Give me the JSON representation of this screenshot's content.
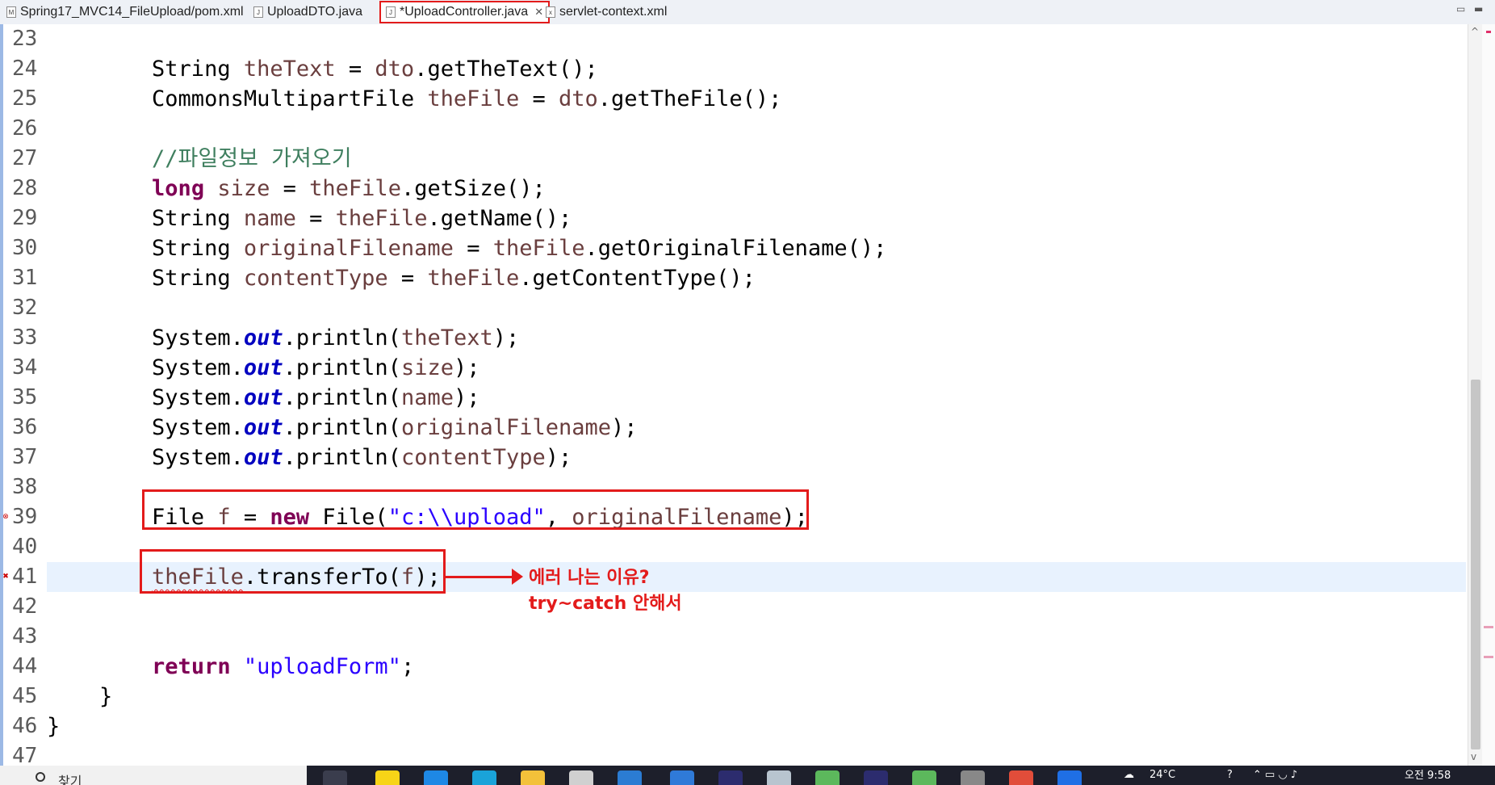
{
  "tabs": [
    {
      "label": "Spring17_MVC14_FileUpload/pom.xml",
      "active": false
    },
    {
      "label": "UploadDTO.java",
      "active": false
    },
    {
      "label": "*UploadController.java",
      "active": true,
      "close": "✕"
    },
    {
      "label": "servlet-context.xml",
      "active": false
    }
  ],
  "window_controls": {
    "minimize": "▭",
    "maximize": "▬"
  },
  "lines": [
    {
      "n": "23",
      "code": ""
    },
    {
      "n": "24",
      "code": "        String theText = dto.getTheText();"
    },
    {
      "n": "25",
      "code": "        CommonsMultipartFile theFile = dto.getTheFile();"
    },
    {
      "n": "26",
      "code": ""
    },
    {
      "n": "27",
      "code": "        //파일정보 가져오기"
    },
    {
      "n": "28",
      "code": "        long size = theFile.getSize();"
    },
    {
      "n": "29",
      "code": "        String name = theFile.getName();"
    },
    {
      "n": "30",
      "code": "        String originalFilename = theFile.getOriginalFilename();"
    },
    {
      "n": "31",
      "code": "        String contentType = theFile.getContentType();"
    },
    {
      "n": "32",
      "code": ""
    },
    {
      "n": "33",
      "code": "        System.out.println(theText);"
    },
    {
      "n": "34",
      "code": "        System.out.println(size);"
    },
    {
      "n": "35",
      "code": "        System.out.println(name);"
    },
    {
      "n": "36",
      "code": "        System.out.println(originalFilename);"
    },
    {
      "n": "37",
      "code": "        System.out.println(contentType);"
    },
    {
      "n": "38",
      "code": ""
    },
    {
      "n": "39",
      "code": "        File f = new File(\"c:\\\\upload\", originalFilename);"
    },
    {
      "n": "40",
      "code": ""
    },
    {
      "n": "41",
      "code": "        theFile.transferTo(f);"
    },
    {
      "n": "42",
      "code": ""
    },
    {
      "n": "43",
      "code": ""
    },
    {
      "n": "44",
      "code": "        return \"uploadForm\";"
    },
    {
      "n": "45",
      "code": "    }"
    },
    {
      "n": "46",
      "code": "}"
    },
    {
      "n": "47",
      "code": ""
    }
  ],
  "annotation": {
    "line1": "에러 나는 이유?",
    "line2": "try~catch 안해서"
  },
  "taskbar": {
    "search_placeholder": "찾기",
    "weather": "24°C",
    "clock": "오전 9:58"
  },
  "colors": {
    "keyword": "#7f0055",
    "static_field": "#0000c0",
    "string": "#2a00ff",
    "comment": "#3f7f5f",
    "variable": "#6a3e3e",
    "highlight": "#e31b1b",
    "current_line": "#e8f2fe"
  }
}
